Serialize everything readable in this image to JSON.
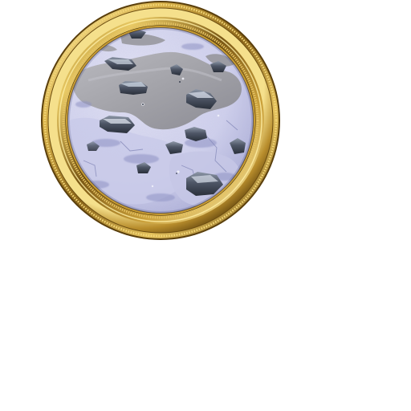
{
  "scene": {
    "background_color": "#ffffff",
    "object": "round-gilded-frame",
    "frame_colors": {
      "gold_light": "#fbe9a0",
      "gold_mid": "#cfa53c",
      "gold_dark": "#6e4f12",
      "bead": "#e6c465"
    },
    "terrain_colors": {
      "ice": "#d4d5ee",
      "ice_shadow": "#8f93c6",
      "water": "#a3a3a9",
      "water_dark": "#7d7d87",
      "rock": "#5a6373",
      "rock_dark": "#2f3542",
      "rock_light": "#c2cad6"
    }
  }
}
